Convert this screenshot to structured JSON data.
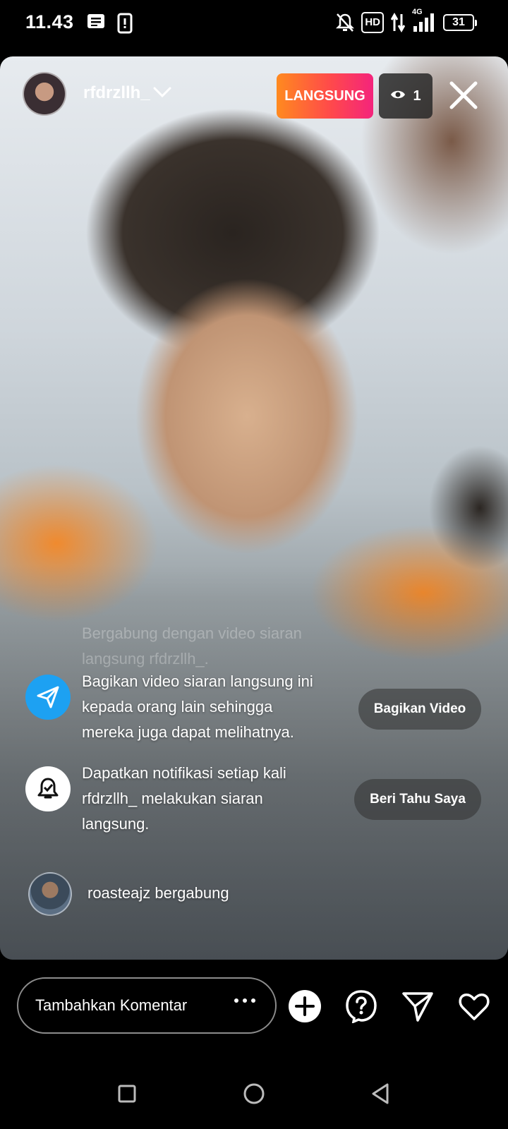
{
  "status_bar": {
    "time": "11.43",
    "icons": [
      "message-icon",
      "sim-icon",
      "mute-notifications-icon",
      "hd-icon",
      "data-arrows-icon",
      "4g-signal-icon"
    ],
    "hd_label": "HD",
    "network_label": "4G",
    "battery_level": "31"
  },
  "live": {
    "host_username": "rfdrzllh_",
    "live_label": "LANGSUNG",
    "viewer_count": "1"
  },
  "feed": {
    "faded_text": "Bergabung dengan video siaran langsung rfdrzllh_.",
    "share_text": "Bagikan video siaran langsung ini kepada orang lain sehingga mereka juga dapat melihatnya.",
    "share_button": "Bagikan Video",
    "notify_text": "Dapatkan notifikasi setiap kali rfdrzllh_ melakukan siaran langsung.",
    "notify_button": "Beri Tahu Saya",
    "join_text": "roasteajz bergabung"
  },
  "comment_bar": {
    "placeholder": "Tambahkan Komentar",
    "icons": [
      "add-icon",
      "question-icon",
      "send-icon",
      "heart-icon"
    ]
  },
  "nav_bar": {
    "icons": [
      "recent-apps-icon",
      "home-icon",
      "back-icon"
    ]
  },
  "colors": {
    "live_gradient_start": "#ff8a1f",
    "live_gradient_end": "#f4247c",
    "share_icon_bg": "#1da1f2",
    "notify_icon_bg": "#ffffff"
  }
}
